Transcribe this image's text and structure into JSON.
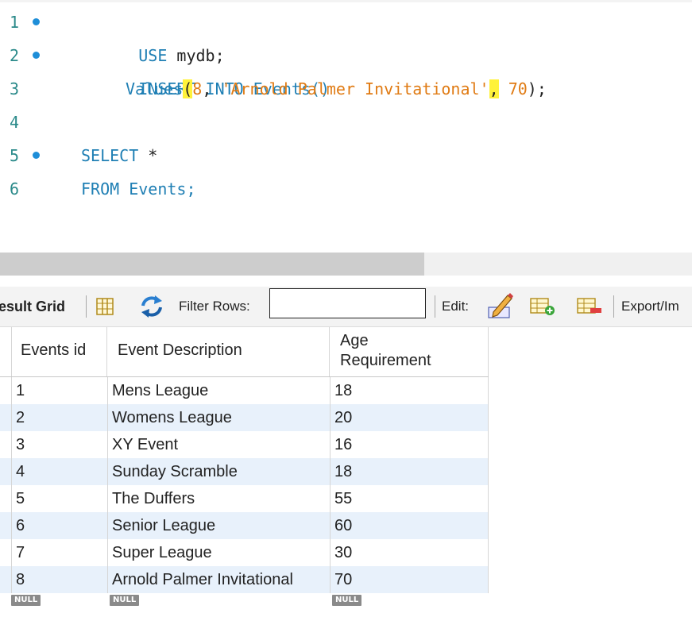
{
  "editor": {
    "lines": [
      {
        "num": "1",
        "parts": [
          {
            "t": "USE",
            "c": "kw"
          },
          {
            "t": " mydb;",
            "c": "pl"
          }
        ]
      },
      {
        "num": "2",
        "parts": [
          {
            "t": "INSERT INTO Events()",
            "c": "kw"
          }
        ]
      },
      {
        "num": "3",
        "parts": [
          {
            "t": "Values",
            "c": "kw"
          },
          {
            "t": "(",
            "c": "pl hl"
          },
          {
            "t": "8",
            "c": "num"
          },
          {
            "t": ", ",
            "c": "pl"
          },
          {
            "t": "'Arnold Palmer Invitational'",
            "c": "str"
          },
          {
            "t": ",",
            "c": "pl hl"
          },
          {
            "t": " ",
            "c": "pl"
          },
          {
            "t": "70",
            "c": "num"
          },
          {
            "t": ");",
            "c": "pl"
          }
        ]
      },
      {
        "num": "4",
        "parts": []
      },
      {
        "num": "5",
        "parts": [
          {
            "t": "SELECT",
            "c": "kw"
          },
          {
            "t": " *",
            "c": "pl"
          }
        ]
      },
      {
        "num": "6",
        "parts": [
          {
            "t": "FROM Events;",
            "c": "kw"
          }
        ]
      }
    ]
  },
  "toolbar": {
    "result_grid_label": "esult Grid",
    "filter_label": "Filter Rows:",
    "filter_value": "",
    "edit_label": "Edit:",
    "export_label": "Export/Im"
  },
  "grid": {
    "columns": [
      "Events id",
      "Event Description",
      "Age",
      "Requirement"
    ],
    "rows": [
      [
        "1",
        "Mens League",
        "18"
      ],
      [
        "2",
        "Womens League",
        "20"
      ],
      [
        "3",
        "XY Event",
        "16"
      ],
      [
        "4",
        "Sunday Scramble",
        "18"
      ],
      [
        "5",
        "The Duffers",
        "55"
      ],
      [
        "6",
        "Senior League",
        "60"
      ],
      [
        "7",
        "Super League",
        "30"
      ],
      [
        "8",
        "Arnold Palmer Invitational",
        "70"
      ]
    ],
    "null_label": "NULL"
  },
  "colors": {
    "keyword": "#1f7fb4",
    "string": "#e07b14",
    "line_number": "#2b8a8a",
    "breakpoint_dot": "#1e8ed8",
    "bracket_highlight": "#fff23a",
    "alt_row": "#e8f1fb"
  }
}
